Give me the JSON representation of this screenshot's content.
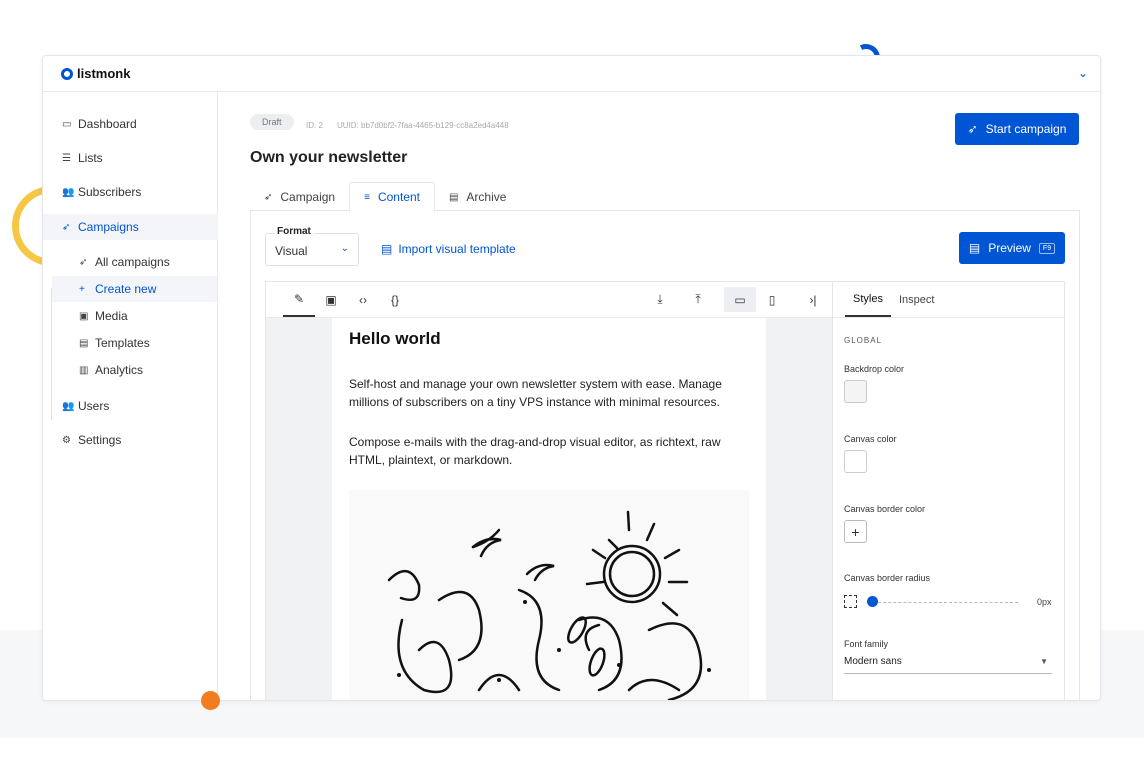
{
  "app": {
    "name": "listmonk"
  },
  "sidebar": {
    "items": [
      {
        "label": "Dashboard",
        "icon": "dashboard-icon"
      },
      {
        "label": "Lists",
        "icon": "list-icon"
      },
      {
        "label": "Subscribers",
        "icon": "users-icon"
      },
      {
        "label": "Campaigns",
        "icon": "rocket-icon",
        "active": true
      },
      {
        "label": "Users",
        "icon": "users-icon"
      },
      {
        "label": "Settings",
        "icon": "gear-icon"
      }
    ],
    "campaign_sub": [
      {
        "label": "All campaigns",
        "icon": "rocket-icon"
      },
      {
        "label": "Create new",
        "icon": "plus-icon",
        "active": true
      },
      {
        "label": "Media",
        "icon": "image-icon"
      },
      {
        "label": "Templates",
        "icon": "file-icon"
      },
      {
        "label": "Analytics",
        "icon": "bar-chart-icon"
      }
    ]
  },
  "campaign": {
    "status": "Draft",
    "id": "ID: 2",
    "uuid": "UUID: bb7d0bf2-7faa-4465-b129-cc8a2ed4a448",
    "title": "Own your newsletter",
    "start_label": "Start campaign"
  },
  "tabs": [
    {
      "label": "Campaign",
      "icon": "rocket-icon"
    },
    {
      "label": "Content",
      "icon": "lines-icon",
      "active": true
    },
    {
      "label": "Archive",
      "icon": "archive-icon"
    }
  ],
  "content": {
    "format_label": "Format",
    "format_value": "Visual",
    "import_label": "Import visual template",
    "preview_label": "Preview",
    "preview_shortcut": "F9"
  },
  "email": {
    "heading": "Hello world",
    "para1": "Self-host and manage your own newsletter system with ease. Manage millions of subscribers on a tiny VPS instance with minimal resources.",
    "para2": "Compose e-mails with the drag-and-drop visual editor, as richtext, raw HTML, plaintext, or markdown."
  },
  "styles_panel": {
    "tab_styles": "Styles",
    "tab_inspect": "Inspect",
    "section": "GLOBAL",
    "backdrop_label": "Backdrop color",
    "backdrop_color": "#f4f4f4",
    "canvas_label": "Canvas color",
    "canvas_color": "#ffffff",
    "border_color_label": "Canvas border color",
    "border_radius_label": "Canvas border radius",
    "border_radius_value": "0px",
    "font_family_label": "Font family",
    "font_family_value": "Modern sans"
  },
  "colors": {
    "accent": "#0055d4"
  }
}
